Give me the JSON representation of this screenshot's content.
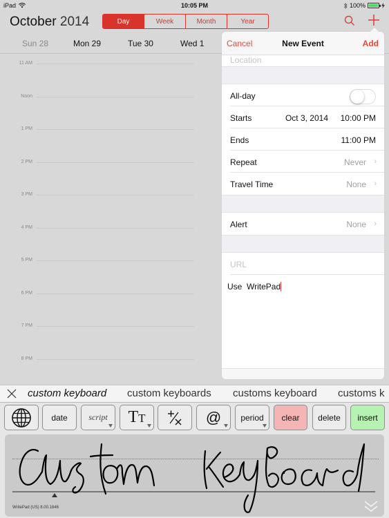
{
  "status_bar": {
    "device": "iPad",
    "time": "10:05 PM",
    "battery_percent": "100%",
    "battery_level": 1.0
  },
  "header": {
    "month": "October",
    "year": "2014",
    "view_tabs": [
      {
        "label": "Day",
        "active": true
      },
      {
        "label": "Week",
        "active": false
      },
      {
        "label": "Month",
        "active": false
      },
      {
        "label": "Year",
        "active": false
      }
    ],
    "search_icon": "magnifier-icon",
    "add_icon": "plus-icon"
  },
  "days": [
    {
      "label": "Sun 28",
      "muted": true
    },
    {
      "label": "Mon 29",
      "muted": false
    },
    {
      "label": "Tue 30",
      "muted": false
    },
    {
      "label": "Wed 1",
      "muted": false
    }
  ],
  "hours": [
    "11 AM",
    "Noon",
    "1 PM",
    "2 PM",
    "3 PM",
    "4 PM",
    "5 PM",
    "6 PM",
    "7 PM",
    "8 PM"
  ],
  "new_event": {
    "cancel_label": "Cancel",
    "title": "New Event",
    "add_label": "Add",
    "location_placeholder": "Location",
    "all_day": {
      "label": "All-day",
      "on": false
    },
    "starts": {
      "label": "Starts",
      "date": "Oct 3, 2014",
      "time": "10:00 PM"
    },
    "ends": {
      "label": "Ends",
      "time": "11:00 PM"
    },
    "repeat": {
      "label": "Repeat",
      "value": "Never"
    },
    "travel_time": {
      "label": "Travel Time",
      "value": "None"
    },
    "alert": {
      "label": "Alert",
      "value": "None"
    },
    "url_placeholder": "URL",
    "notes": "Use  WritePad"
  },
  "suggestions": [
    "custom keyboard",
    "custom keyboards",
    "customs keyboard",
    "customs k"
  ],
  "keyboard": {
    "keys": [
      {
        "name": "globe",
        "label": "",
        "icon": "globe-icon"
      },
      {
        "name": "date",
        "label": "date"
      },
      {
        "name": "script",
        "label": "script",
        "dropdown": true
      },
      {
        "name": "text-size",
        "label": "TT",
        "dropdown": true
      },
      {
        "name": "math",
        "label": "+/×"
      },
      {
        "name": "at",
        "label": "@",
        "dropdown": true
      },
      {
        "name": "period",
        "label": "period",
        "dropdown": true
      },
      {
        "name": "clear",
        "label": "clear"
      },
      {
        "name": "delete",
        "label": "delete"
      },
      {
        "name": "insert",
        "label": "insert"
      }
    ],
    "handwriting_text": "custom keyboard",
    "version": "WritePad (US) 8.00.1846"
  }
}
